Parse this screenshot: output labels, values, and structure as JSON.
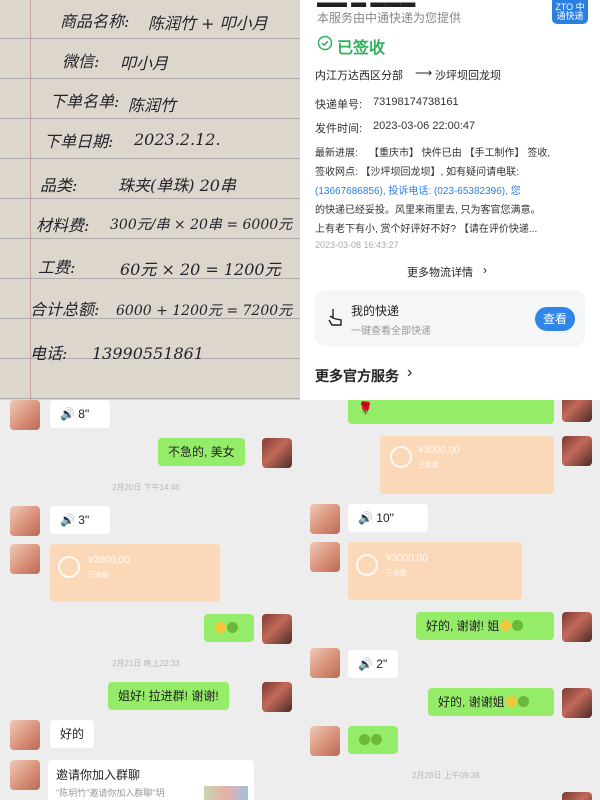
{
  "paper": {
    "rows": [
      {
        "label": "商品名称:",
        "value": "陈润竹 + 叩小月"
      },
      {
        "label": "微信:",
        "value": "叩小月"
      },
      {
        "label": "下单名单:",
        "value": "陈润竹"
      },
      {
        "label": "下单日期:",
        "value": "2023.2.12."
      },
      {
        "label": "品类:",
        "value": "珠夹(单珠) 20串"
      },
      {
        "label": "材料费:",
        "value": "300元/串 × 20串 = 6000元"
      },
      {
        "label": "工费:",
        "value": "60元 × 20 = 1200元"
      },
      {
        "label": "合计总额:",
        "value": "6000 + 1200元 = 7200元"
      },
      {
        "label": "电话:",
        "value": "13990551861"
      }
    ]
  },
  "express": {
    "provider_note": "本服务由中通快递为您提供",
    "logo_text": "ZTO 中通快递",
    "status": "已签收",
    "route_from": "内江万达西区分部",
    "route_arrow": "⟶",
    "route_to": "沙坪坝回龙坝",
    "tracking_label": "快递单号:",
    "tracking_no": "73198174738161",
    "ship_time_label": "发件时间:",
    "ship_time": "2023-03-06 22:00:47",
    "latest_label": "最新进展:",
    "latest_lines": [
      "【重庆市】 快件已由 【手工制作】 签收,",
      "签收网点: 【沙坪坝回龙坝】, 如有疑问请电联:",
      "(13667686856), 投诉电话: (023-65382396), 您",
      "的快递已经妥投。风里来雨里去, 只为客官您满意。",
      "上有老下有小, 赏个好评好不好? 【请在评价快递..."
    ],
    "latest_time": "2023-03-08 16:43:27",
    "more_logistics": "更多物流详情",
    "my_express_title": "我的快递",
    "my_express_sub": "一键查看全部快递",
    "view_btn": "查看",
    "more_services": "更多官方服务"
  },
  "chat_left": {
    "msgs": [
      {
        "voice": "8\""
      },
      {
        "text": "不急的, 美女"
      },
      {
        "time": "2月20日 下午14:46"
      },
      {
        "voice": "3\""
      },
      {
        "transfer_amount": "¥3000.00",
        "transfer_status": "已收款"
      },
      {
        "time": "2月21日 晚上22:33"
      },
      {
        "text": "姐好! 拉进群! 谢谢!"
      },
      {
        "text": "好的"
      },
      {
        "text": "邀请你加入群聊",
        "sub": "\"陈玥竹\"邀请你加入群聊\"玥"
      }
    ]
  },
  "chat_right": {
    "msgs": [
      {
        "transfer_amount": "¥3000.00",
        "transfer_status": "已收款"
      },
      {
        "voice": "10\""
      },
      {
        "transfer_amount": "¥3000.00",
        "transfer_status": "已收款"
      },
      {
        "text": "好的, 谢谢! 姐"
      },
      {
        "voice": "2\""
      },
      {
        "text": "好的, 谢谢姐"
      },
      {
        "time": "2月28日 上午09:38"
      }
    ]
  }
}
